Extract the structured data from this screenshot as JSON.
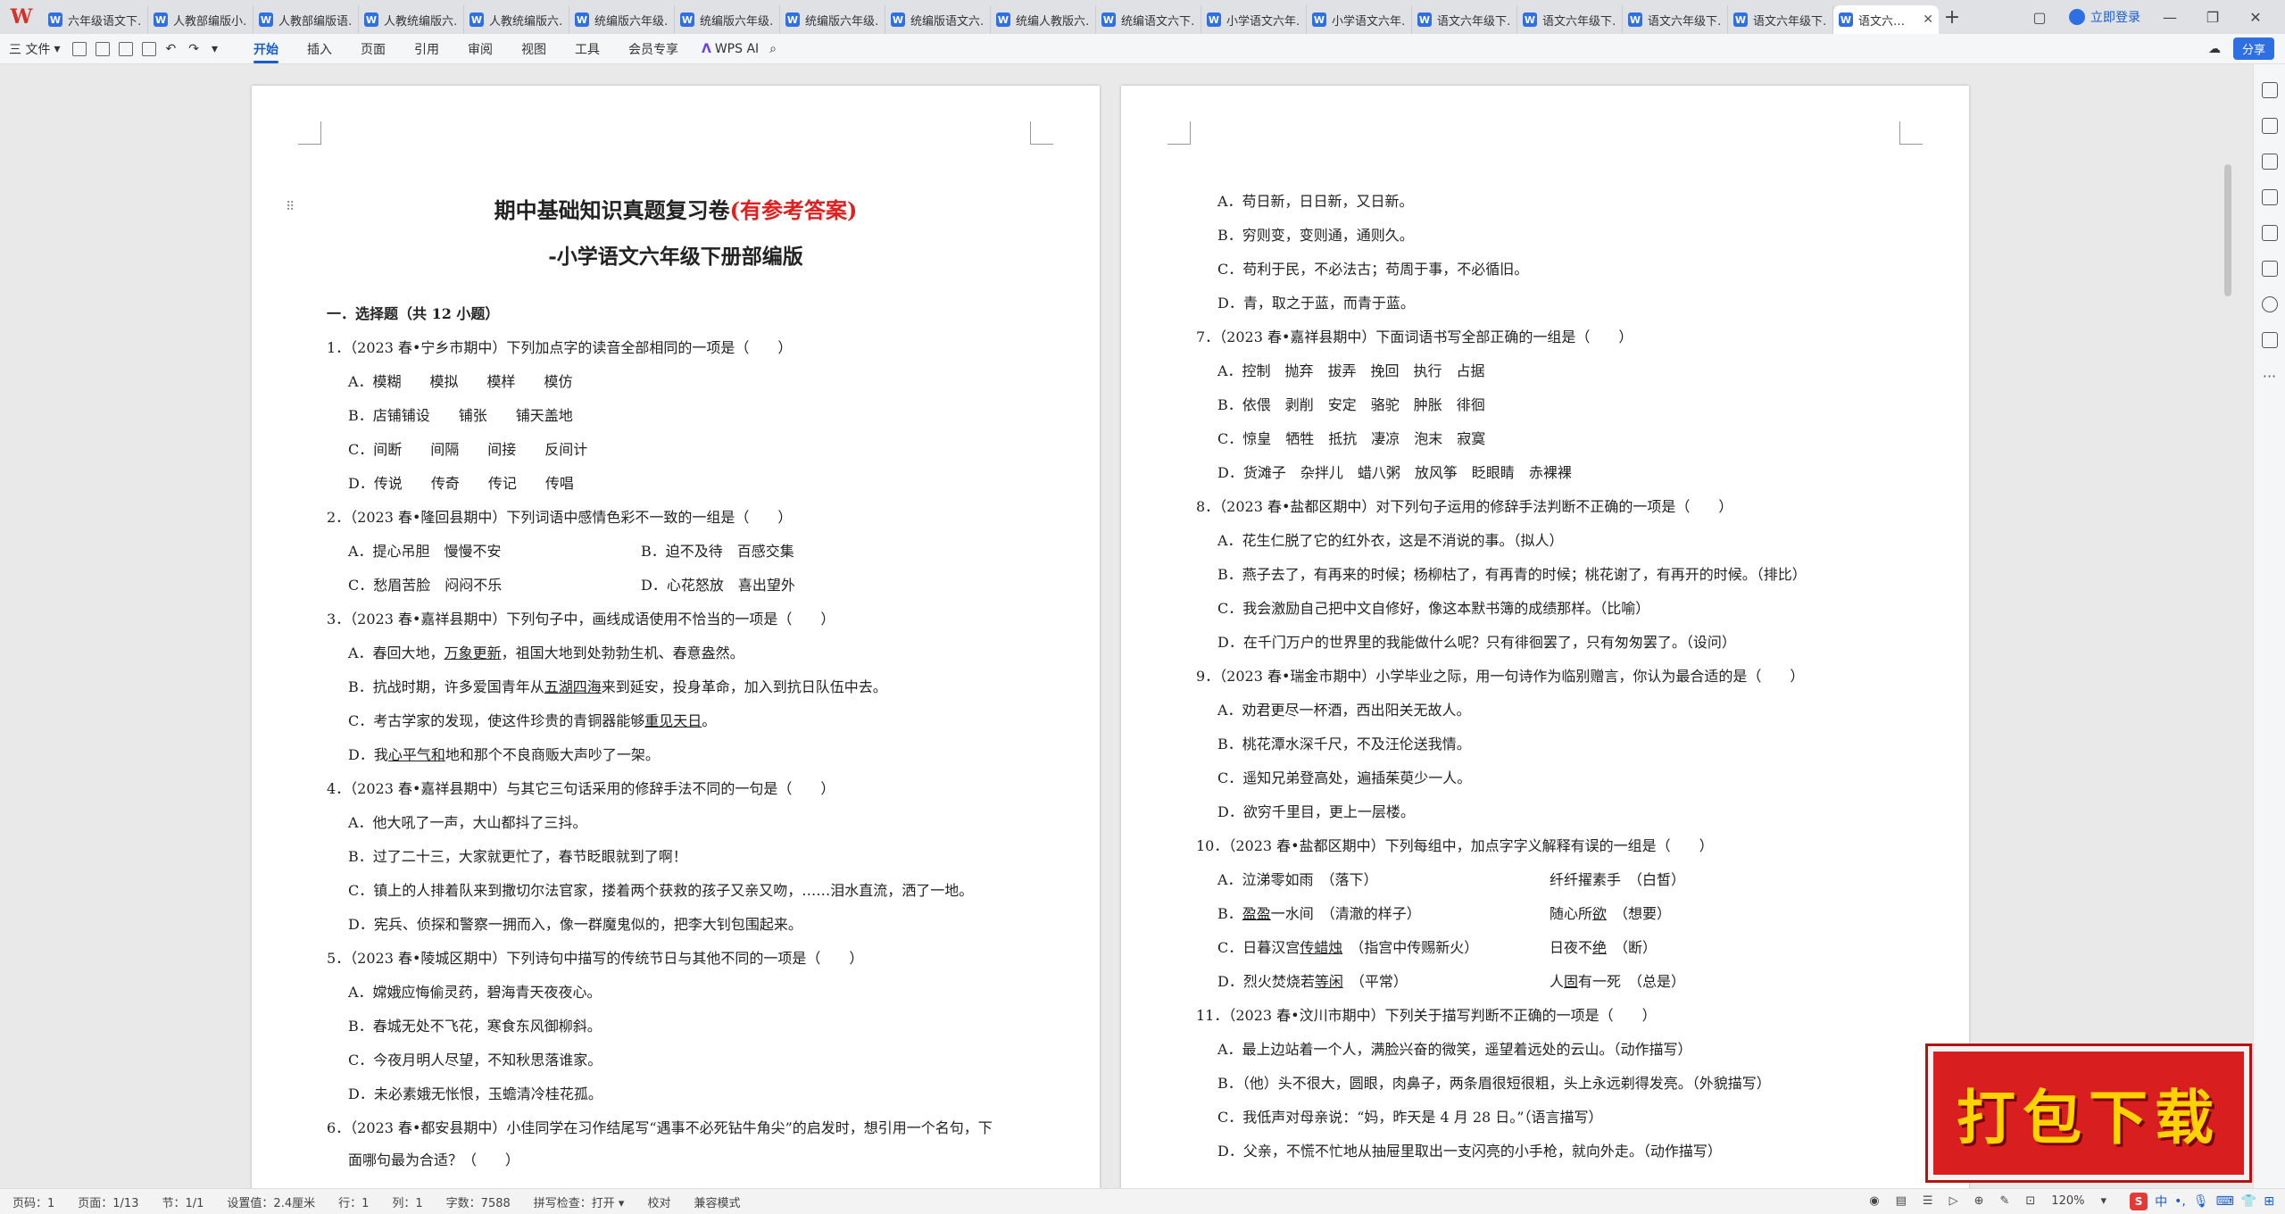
{
  "app": {
    "logo": "W"
  },
  "tabs": [
    "六年级语文下…",
    "人教部编版小…",
    "人教部编版语…",
    "人教统编版六…",
    "人教统编版六…",
    "统编版六年级…",
    "统编版六年级…",
    "统编版六年级…",
    "统编版语文六…",
    "统编人教版六…",
    "统编语文六下…",
    "小学语文六年…",
    "小学语文六年…",
    "语文六年级下…",
    "语文六年级下…",
    "语文六年级下…",
    "语文六年级下…",
    "语文六…"
  ],
  "tabbar": {
    "login": "立即登录"
  },
  "toolbar": {
    "file": "三 文件",
    "ribbon_tabs": [
      "开始",
      "插入",
      "页面",
      "引用",
      "审阅",
      "视图",
      "工具",
      "会员专享"
    ],
    "wps_ai": "WPS AI",
    "share": "分享"
  },
  "page1": {
    "title_main": "期中基础知识真题复习卷",
    "title_red": "(有参考答案)",
    "subtitle": "-小学语文六年级下册部编版",
    "section": "一．选择题（共 12 小题）",
    "q1": "1．（2023 春•宁乡市期中）下列加点字的读音全部相同的一项是（　　）",
    "q1a": "A．模糊　　模拟　　模样　　模仿",
    "q1b": "B．店铺铺设　　铺张　　铺天盖地",
    "q1c": "C．间断　　间隔　　间接　　反间计",
    "q1d": "D．传说　　传奇　　传记　　传唱",
    "q2": "2．（2023 春•隆回县期中）下列词语中感情色彩不一致的一组是（　　）",
    "q2a": "A．提心吊胆　慢慢不安",
    "q2b": "B．迫不及待　百感交集",
    "q2c": "C．愁眉苦脸　闷闷不乐",
    "q2d": "D．心花怒放　喜出望外",
    "q3": "3．（2023 春•嘉祥县期中）下列句子中，画线成语使用不恰当的一项是（　　）",
    "q3a_1": "A．春回大地，",
    "q3a_u": "万象更新",
    "q3a_2": "，祖国大地到处勃勃生机、春意盎然。",
    "q3b_1": "B．抗战时期，许多爱国青年从",
    "q3b_u": "五湖四海",
    "q3b_2": "来到延安，投身革命，加入到抗日队伍中去。",
    "q3c_1": "C．考古学家的发现，使这件珍贵的青铜器能够",
    "q3c_u": "重见天日",
    "q3c_2": "。",
    "q3d_1": "D．我",
    "q3d_u": "心平气和",
    "q3d_2": "地和那个不良商贩大声吵了一架。",
    "q4": "4．（2023 春•嘉祥县期中）与其它三句话采用的修辞手法不同的一句是（　　）",
    "q4a": "A．他大吼了一声，大山都抖了三抖。",
    "q4b": "B．过了二十三，大家就更忙了，春节眨眼就到了啊！",
    "q4c": "C．镇上的人排着队来到撒切尔法官家，搂着两个获救的孩子又亲又吻，……泪水直流，洒了一地。",
    "q4d": "D．宪兵、侦探和警察一拥而入，像一群魔鬼似的，把李大钊包围起来。",
    "q5": "5．（2023 春•陵城区期中）下列诗句中描写的传统节日与其他不同的一项是（　　）",
    "q5a": "A．嫦娥应悔偷灵药，碧海青天夜夜心。",
    "q5b": "B．春城无处不飞花，寒食东风御柳斜。",
    "q5c": "C．今夜月明人尽望，不知秋思落谁家。",
    "q5d": "D．未必素娥无怅恨，玉蟾清冷桂花孤。",
    "q6": "6．（2023 春•都安县期中）小佳同学在习作结尾写“遇事不必死钻牛角尖”的启发时，想引用一个名句，下",
    "q6b": "面哪句最为合适？（　　）"
  },
  "page2": {
    "q6a": "A．苟日新，日日新，又日新。",
    "q6bb": "B．穷则变，变则通，通则久。",
    "q6c": "C．苟利于民，不必法古；苟周于事，不必循旧。",
    "q6d": "D．青，取之于蓝，而青于蓝。",
    "q7": "7．（2023 春•嘉祥县期中）下面词语书写全部正确的一组是（　　）",
    "q7a": "A．控制　抛弃　拔弄　挽回　执行　占据",
    "q7b": "B．依偎　剥削　安定　骆驼　肿胀　徘徊",
    "q7c": "C．惊皇　牺牲　抵抗　凄凉　泡末　寂寞",
    "q7d": "D．货滩子　杂拌儿　蜡八粥　放风筝　眨眼睛　赤裸裸",
    "q8": "8．（2023 春•盐都区期中）对下列句子运用的修辞手法判断不正确的一项是（　　）",
    "q8a": "A．花生仁脱了它的红外衣，这是不消说的事。（拟人）",
    "q8b": "B．燕子去了，有再来的时候；杨柳枯了，有再青的时候；桃花谢了，有再开的时候。（排比）",
    "q8c": "C．我会激励自己把中文自修好，像这本默书簿的成绩那样。（比喻）",
    "q8d": "D．在千门万户的世界里的我能做什么呢？只有徘徊罢了，只有匆匆罢了。（设问）",
    "q9": "9．（2023 春•瑞金市期中）小学毕业之际，用一句诗作为临别赠言，你认为最合适的是（　　）",
    "q9a": "A．劝君更尽一杯酒，西出阳关无故人。",
    "q9b": "B．桃花潭水深千尺，不及汪伦送我情。",
    "q9c": "C．遥知兄弟登高处，遍插茱萸少一人。",
    "q9d": "D．欲穷千里目，更上一层楼。",
    "q10": "10．（2023 春•盐都区期中）下列每组中，加点字字义解释有误的一组是（　　）",
    "q10a1": "A．泣涕零如雨　（落下）",
    "q10a2": "纤纤擢素手　（白皙）",
    "q10b1_pre": "B．",
    "q10b1_u": "盈盈",
    "q10b1_post": "一水间　（清澈的样子）",
    "q10b2_pre": "随心所",
    "q10b2_u": "欲",
    "q10b2_post": "　（想要）",
    "q10c1_pre": "C．日暮汉宫",
    "q10c1_u": "传蜡烛",
    "q10c1_post": "　（指宫中传赐新火）",
    "q10c2_pre": "日夜不",
    "q10c2_u": "绝",
    "q10c2_post": "　（断）",
    "q10d1_pre": "D．烈火焚烧若",
    "q10d1_u": "等闲",
    "q10d1_post": "　（平常）",
    "q10d2_pre": "人",
    "q10d2_u": "固",
    "q10d2_post": "有一死　（总是）",
    "q11": "11．（2023 春•汶川市期中）下列关于描写判断不正确的一项是（　　）",
    "q11a": "A．最上边站着一个人，满脸兴奋的微笑，遥望着远处的云山。（动作描写）",
    "q11b": "B．（他）头不很大，圆眼，肉鼻子，两条眉很短很粗，头上永远剃得发亮。（外貌描写）",
    "q11c": "C．我低声对母亲说：“妈，昨天是 4 月 28 日。”（语言描写）",
    "q11d": "D．父亲，不慌不忙地从抽屉里取出一支闪亮的小手枪，就向外走。（动作描写）"
  },
  "status": {
    "page_code": "页码：1",
    "pages": "页面：1/13",
    "section": "节：1/1",
    "setting": "设置值：2.4厘米",
    "row": "行：1",
    "col": "列：1",
    "words": "字数：7588",
    "spell": "拼写检查：打开 ▾",
    "proof": "校对",
    "compat": "兼容模式",
    "zoom": "120%",
    "ime": "中"
  },
  "banner": {
    "text": "打包下载"
  }
}
